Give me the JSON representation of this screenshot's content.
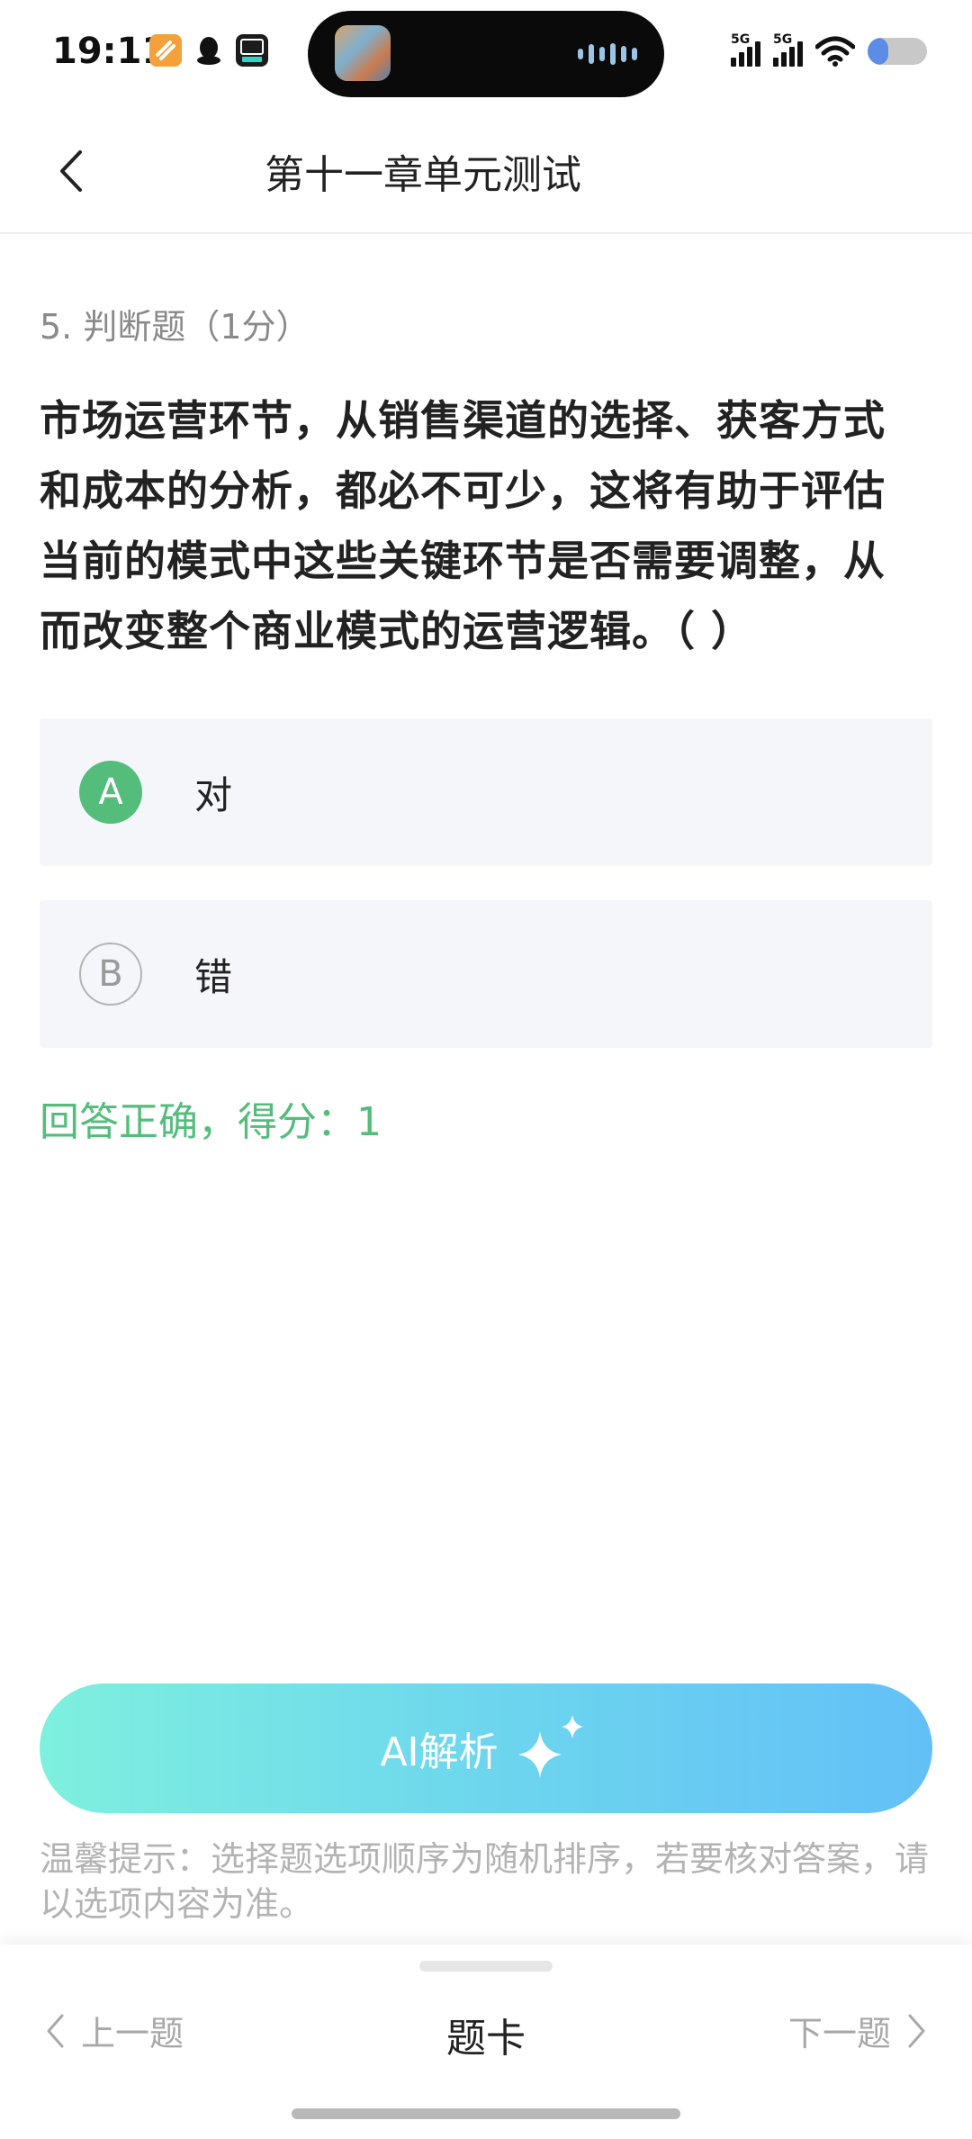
{
  "status_bar": {
    "time": "19:11",
    "signal_1": "5G",
    "signal_2": "5G",
    "battery_level": 0.35
  },
  "nav": {
    "title": "第十一章单元测试"
  },
  "question": {
    "meta": "5. 判断题（1分）",
    "text": "市场运营环节，从销售渠道的选择、获客方式和成本的分析，都必不可少，这将有助于评估当前的模式中这些关键环节是否需要调整，从而改变整个商业模式的运营逻辑。（ ）"
  },
  "options": [
    {
      "letter": "A",
      "text": "对",
      "state": "correct"
    },
    {
      "letter": "B",
      "text": "错",
      "state": "unselected"
    }
  ],
  "result_text": "回答正确，得分：1",
  "ai_button": {
    "label": "AI解析"
  },
  "tip": "温馨提示：选择题选项顺序为随机排序，若要核对答案，请以选项内容为准。",
  "bottom_bar": {
    "prev_label": "上一题",
    "card_label": "题卡",
    "next_label": "下一题"
  },
  "colors": {
    "correct_green": "#54bd7c",
    "ai_gradient_start": "#7ef0de",
    "ai_gradient_end": "#63c0f7"
  },
  "icons": [
    "back-arrow-icon",
    "sparkle-icon",
    "chevron-left-icon",
    "chevron-right-icon",
    "wifi-icon",
    "signal-icon",
    "battery-icon"
  ]
}
